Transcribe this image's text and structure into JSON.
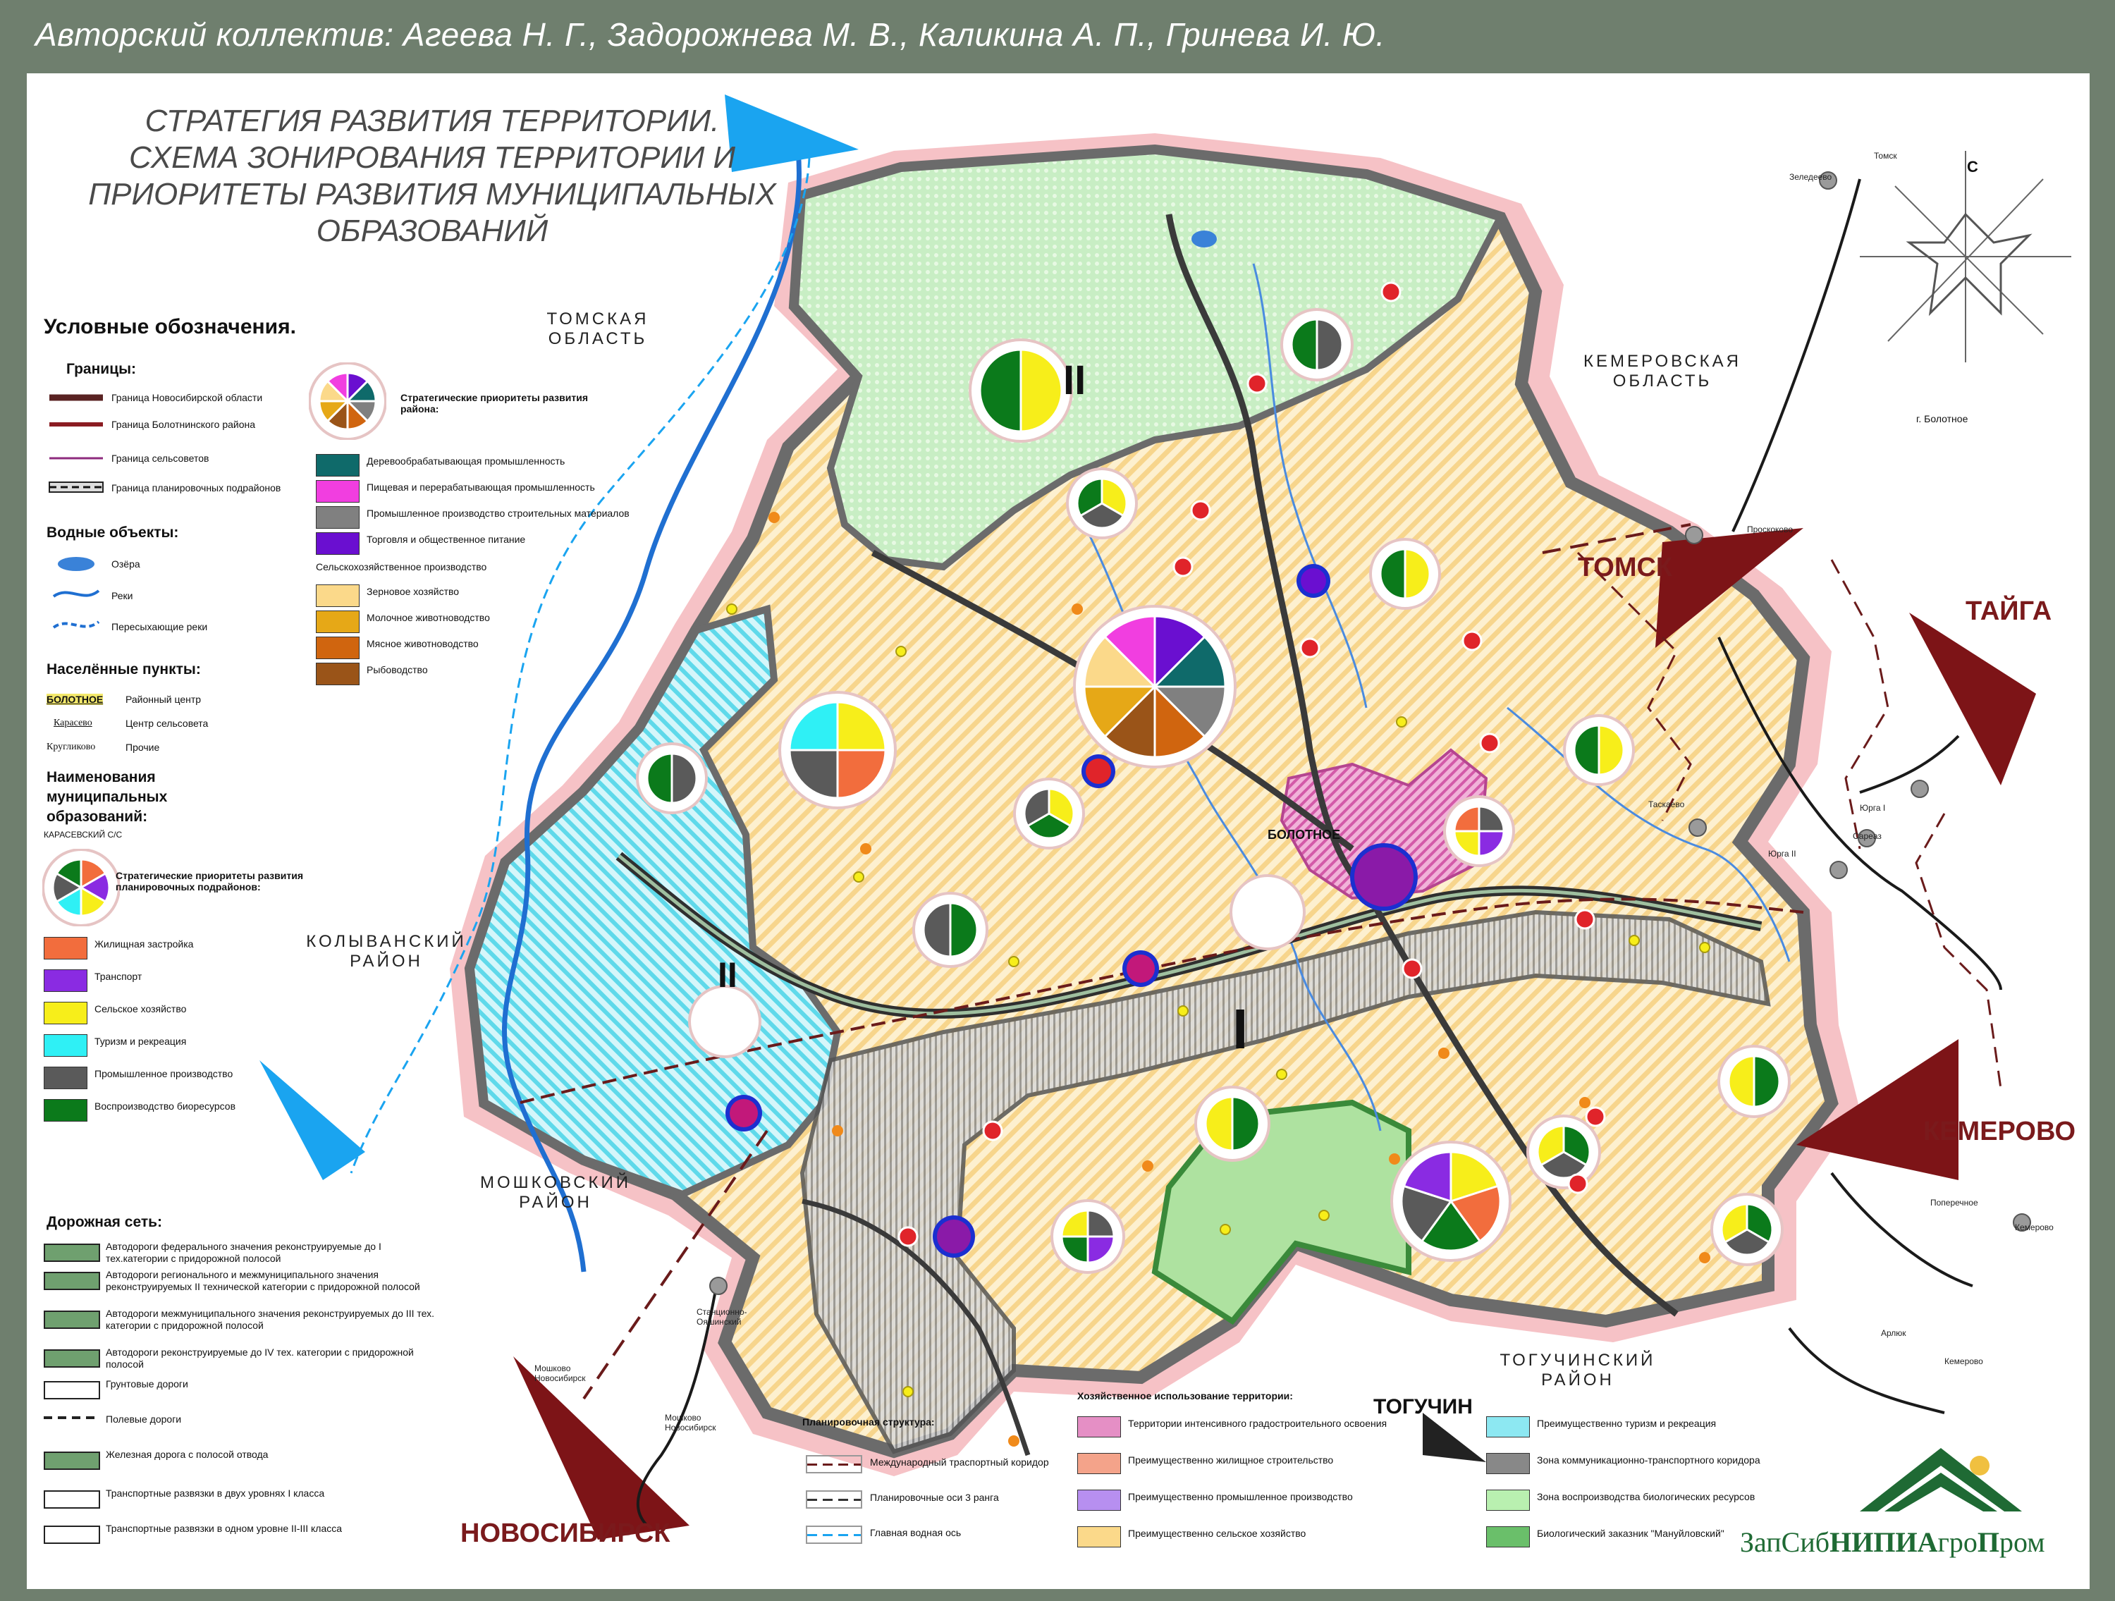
{
  "authors": "Авторский коллектив: Агеева Н. Г., Задорожнева М. В., Каликина А. П., Гринева И. Ю.",
  "title_lines": [
    "СТРАТЕГИЯ РАЗВИТИЯ ТЕРРИТОРИИ.",
    "СХЕМА ЗОНИРОВАНИЯ ТЕРРИТОРИИ И",
    "ПРИОРИТЕТЫ РАЗВИТИЯ МУНИЦИПАЛЬНЫХ",
    "ОБРАЗОВАНИЙ"
  ],
  "legend": {
    "title": "Условные обозначения.",
    "borders": {
      "heading": "Границы:",
      "items": [
        "Граница Новосибирской области",
        "Граница Болотнинского района",
        "Граница сельсоветов",
        "Граница планировочных подрайонов"
      ]
    },
    "water": {
      "heading": "Водные объекты:",
      "items": [
        "Озёра",
        "Реки",
        "Пересыхающие реки"
      ]
    },
    "settlements": {
      "heading": "Населённые пункты:",
      "items": [
        {
          "sample": "БОЛОТНОЕ",
          "label": "Районный центр"
        },
        {
          "sample": "Карасево",
          "label": "Центр сельсовета"
        },
        {
          "sample": "Кругликово",
          "label": "Прочие"
        }
      ]
    },
    "mo_names": {
      "heading": "Наименования муниципальных образований:",
      "sample": "КАРАСЕВСКИЙ С/С"
    },
    "subdistrict_priorities": {
      "heading": "Стратегические приоритеты развития планировочных подрайонов:",
      "items": [
        {
          "label": "Жилищная застройка",
          "color": "#f26d3d"
        },
        {
          "label": "Транспорт",
          "color": "#8a2be2"
        },
        {
          "label": "Сельское хозяйство",
          "color": "#f7ee1a"
        },
        {
          "label": "Туризм и рекреация",
          "color": "#2ff0f5"
        },
        {
          "label": "Промышленное производство",
          "color": "#5a5a5a"
        },
        {
          "label": "Воспроизводство биоресурсов",
          "color": "#0b7a1b"
        }
      ]
    },
    "district_priorities": {
      "heading": "Стратегические приоритеты развития района:",
      "items": [
        {
          "label": "Деревообрабатывающая промышленность",
          "color": "#0f6a6a"
        },
        {
          "label": "Пищевая и перерабатывающая промышленность",
          "color": "#f13ee0"
        },
        {
          "label": "Промышленное производство строительных материалов",
          "color": "#808080"
        },
        {
          "label": "Торговля и общественное питание",
          "color": "#6a0fd0"
        },
        {
          "label": "Сельскохозяйственное производство",
          "color": ""
        },
        {
          "label": "Зерновое хозяйство",
          "color": "#fbd98a"
        },
        {
          "label": "Молочное животноводство",
          "color": "#e6a817"
        },
        {
          "label": "Мясное животноводство",
          "color": "#d0650f"
        },
        {
          "label": "Рыбоводство",
          "color": "#9a5418"
        }
      ]
    },
    "roads": {
      "heading": "Дорожная сеть:",
      "items": [
        "Автодороги федерального значения реконструируемые до I тех.категории с придорожной полосой",
        "Автодороги регионального и межмуниципального значения реконструируемых II технической категории с придорожной полосой",
        "Автодороги межмуниципального значения реконструируемых до III тех. категории с придорожной полосой",
        "Автодороги реконструируемые до IV тех. категории с придорожной полосой",
        "Грунтовые дороги",
        "Полевые дороги",
        "Железная дорога с полосой отвода",
        "Транспортные развязки в двух уровнях I класса",
        "Транспортные развязки в одном уровне II-III класса"
      ]
    },
    "planning_structure": {
      "heading": "Планировочная структура:",
      "items": [
        "Международный траспортный коридор",
        "Планировочные оси 3 ранга",
        "Главная водная ось"
      ]
    },
    "land_use": {
      "heading": "Хозяйственное использование территории:",
      "items": [
        {
          "label": "Территории интенсивного градостроительного освоения",
          "color": "#e58fc5"
        },
        {
          "label": "Преимущественно жилищное строительство",
          "color": "#f4a38a"
        },
        {
          "label": "Преимущественно промышленное производство",
          "color": "#b78ff0"
        },
        {
          "label": "Преимущественно сельское хозяйство",
          "color": "#fbd98a"
        },
        {
          "label": "Преимущественно туризм и рекреация",
          "color": "#8de8f2"
        },
        {
          "label": "Зона коммуникационно-транспортного коридора",
          "color": "#888888"
        },
        {
          "label": "Зона воспроизводства биологических ресурсов",
          "color": "#b9f0b0"
        },
        {
          "label": "Биологический заказник \"Мануйловский\"",
          "color": "#6abf6a"
        }
      ]
    }
  },
  "regions": {
    "tomsk_obl": "ТОМСКАЯ ОБЛАСТЬ",
    "kemerovo_obl": "КЕМЕРОВСКАЯ ОБЛАСТЬ",
    "kolyvan": "КОЛЫВАНСКИЙ РАЙОН",
    "moshkovo": "МОШКОВСКИЙ РАЙОН",
    "toguchin": "ТОГУЧИНСКИЙ РАЙОН"
  },
  "cities": {
    "tomsk": "ТОМСК",
    "taiga": "ТАЙГА",
    "kemerovo": "КЕМЕРОВО",
    "novosibirsk": "НОВОСИБИРСК",
    "toguchin": "ТОГУЧИН"
  },
  "district_center": "БОЛОТНОЕ",
  "subdistricts": [
    "I",
    "II",
    "II"
  ],
  "inset": {
    "north": "С",
    "caption": "г. Болотное",
    "towns": [
      "Зеледеево",
      "Томск",
      "Проскоково",
      "Таскаево",
      "Юрга I",
      "Юрга II",
      "Сареаз",
      "Поперечное",
      "Кемерово",
      "Арлюк",
      "Кемерово",
      "Станционно-Ояшинский",
      "Мошково Новосибирск",
      "Мошково Новосибирск"
    ]
  },
  "logo": {
    "part1": "ЗапСиб",
    "part2": "НИПИА",
    "part3": "гро",
    "part4": "П",
    "part5": "ром"
  }
}
